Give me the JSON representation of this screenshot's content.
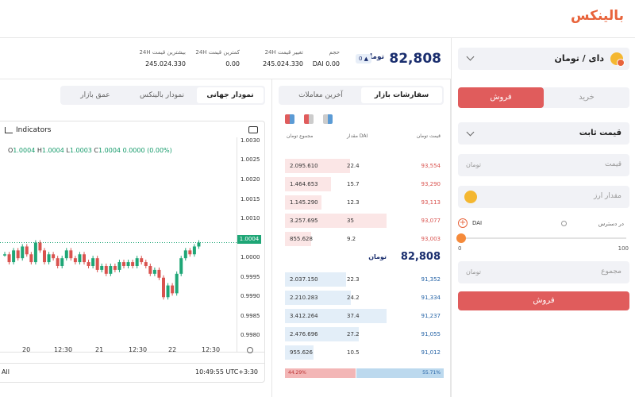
{
  "logo": "بالینکس",
  "pair": {
    "name": "دای / تومان"
  },
  "trade_tabs": {
    "sell": "فروش",
    "buy": "خرید"
  },
  "order_type": "قیمت ثابت",
  "fields": {
    "price": "قیمت",
    "amount": "مقدار ارز",
    "total": "مجموع",
    "currency": "تومان"
  },
  "available": "در دسترس",
  "dai": "DAI",
  "slider": {
    "min": "0",
    "max": "100",
    "value": 0
  },
  "submit": "فروش",
  "stats": {
    "price": "82,808",
    "currency": "تومان",
    "change": "0",
    "volume_label": "حجم",
    "volume_value": "0.00 DAI",
    "change24_label": "تغییر قیمت 24H",
    "change24_value": "245.024.330",
    "low_label": "کمترین قیمت 24H",
    "low_value": "0.00",
    "high_label": "بیشترین قیمت 24H",
    "high_value": "245.024.330"
  },
  "book": {
    "tab_active": "سفارشات بازار",
    "tab_other": "آخرین معاملات",
    "headers": {
      "price": "قیمت",
      "amount": "مقدار DAI",
      "total": "مجموع"
    },
    "currency": "تومان",
    "sells": [
      {
        "total": "2.095.610",
        "amount": "22.4",
        "price": "93,554",
        "depth": 0.64
      },
      {
        "total": "1.464.653",
        "amount": "15.7",
        "price": "93,290",
        "depth": 0.45
      },
      {
        "total": "1.145.290",
        "amount": "12.3",
        "price": "93,113",
        "depth": 0.36
      },
      {
        "total": "3.257.695",
        "amount": "35",
        "price": "93,077",
        "depth": 1.0
      },
      {
        "total": "855.628",
        "amount": "9.2",
        "price": "93,003",
        "depth": 0.26
      }
    ],
    "mid_price": "82,808",
    "buys": [
      {
        "total": "2.037.150",
        "amount": "22.3",
        "price": "91,352",
        "depth": 0.6
      },
      {
        "total": "2.210.283",
        "amount": "24.2",
        "price": "91,334",
        "depth": 0.65
      },
      {
        "total": "3.412.264",
        "amount": "37.4",
        "price": "91,237",
        "depth": 1.0
      },
      {
        "total": "2.476.696",
        "amount": "27.2",
        "price": "91,055",
        "depth": 0.73
      },
      {
        "total": "955.626",
        "amount": "10.5",
        "price": "91,012",
        "depth": 0.28
      }
    ],
    "sell_ratio": "44.29%",
    "buy_ratio": "55.71%",
    "sell_ratio_value": 0.4429
  },
  "chart_tabs": {
    "global": "نمودار جهانی",
    "balinex": "نمودار بالینکس",
    "depth": "عمق بازار"
  },
  "chart": {
    "indicators": "Indicators",
    "ohlc": {
      "o": "1.0004",
      "h": "1.0004",
      "l": "1.0003",
      "c": "1.0004",
      "chg": "0.0000 (0.00%)"
    },
    "current_price": "1.0004",
    "range_label": "All",
    "clock": "10:49:55 UTC+3:30"
  },
  "chart_data": {
    "type": "line",
    "y_ticks": [
      "1.0030",
      "1.0025",
      "1.0020",
      "1.0015",
      "1.0010",
      "1.0005",
      "1.0000",
      "0.9995",
      "0.9990",
      "0.9985",
      "0.9980"
    ],
    "x_ticks": [
      "20",
      "12:30",
      "21",
      "12:30",
      "22",
      "12:30"
    ],
    "ylim": [
      0.9976,
      1.0031
    ],
    "series": [
      {
        "values": [
          1.0001,
          0.9999,
          1.0002,
          1.0,
          1.0003,
          1.0001,
          0.9999,
          1.0004,
          1.0002,
          0.9999,
          1.0001,
          1.0,
          0.9998,
          1.0,
          1.0002,
          1.0,
          0.9999,
          1.0001,
          0.9999,
          0.9998,
          1.0,
          0.9997,
          0.9998,
          0.9996,
          0.9998,
          0.9997,
          0.9999,
          0.9998,
          0.9999,
          0.9998,
          1.0,
          0.9999,
          0.9998,
          0.9996,
          0.9997,
          0.9995,
          0.999,
          0.9993,
          0.9991,
          0.9996,
          1.0,
          1.0002,
          1.0001,
          1.0003,
          1.0004
        ]
      }
    ]
  }
}
